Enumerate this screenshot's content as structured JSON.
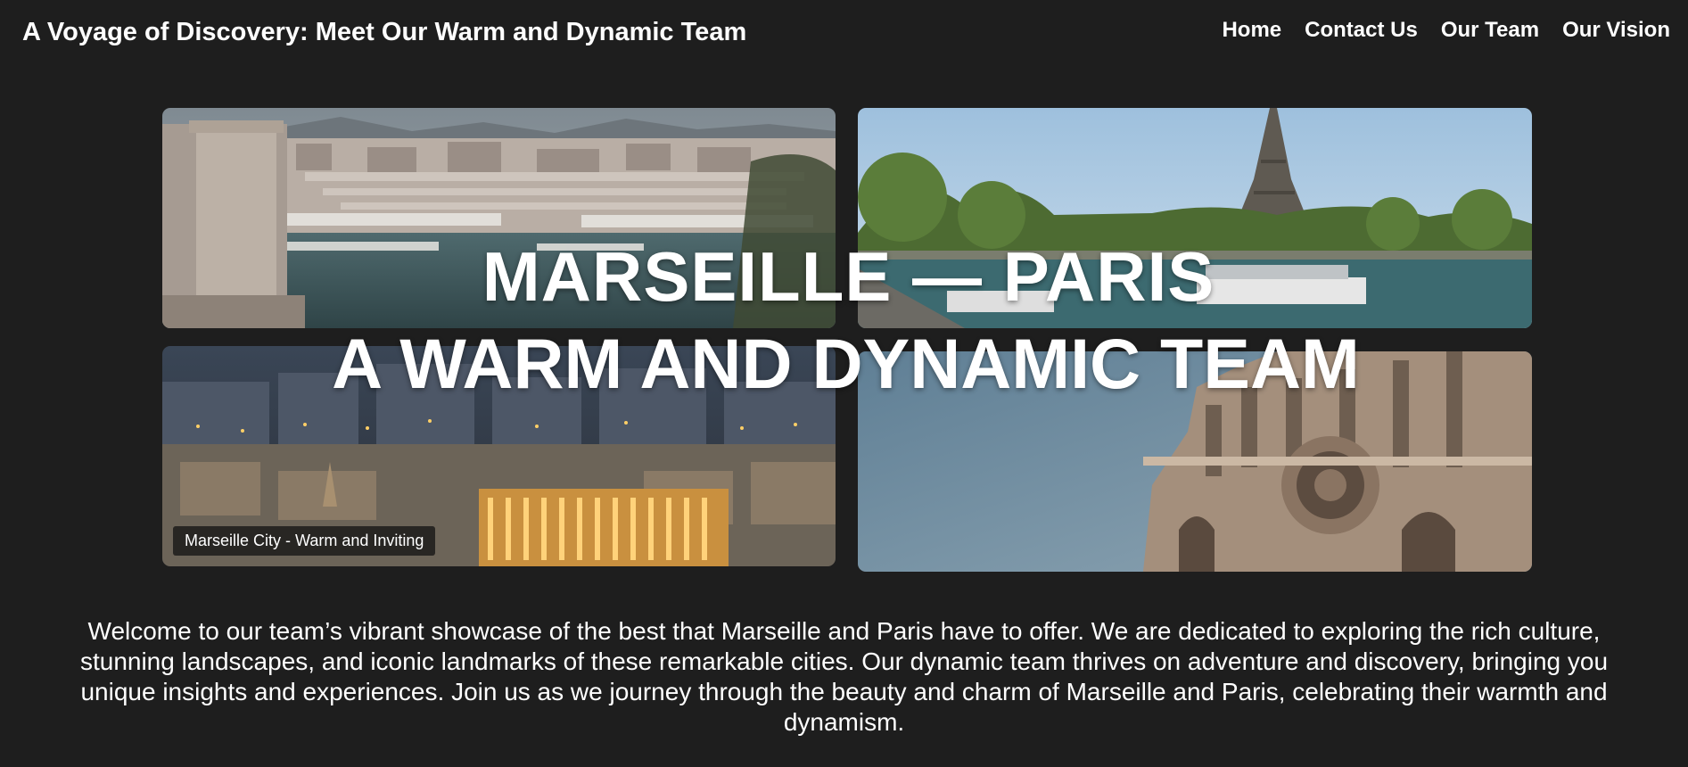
{
  "header": {
    "title": "A Voyage of Discovery: Meet Our Warm and Dynamic Team",
    "nav": [
      {
        "label": "Home"
      },
      {
        "label": "Contact Us"
      },
      {
        "label": "Our Team"
      },
      {
        "label": "Our Vision"
      }
    ]
  },
  "hero": {
    "line1": "MARSEILLE — PARIS",
    "line2": "A WARM AND DYNAMIC TEAM",
    "tiles": [
      {
        "name": "marseille-port-photo"
      },
      {
        "name": "paris-eiffel-photo"
      },
      {
        "name": "marseille-night-photo",
        "caption": "Marseille City - Warm and Inviting"
      },
      {
        "name": "notre-dame-photo"
      }
    ]
  },
  "intro": {
    "text": "Welcome to our team’s vibrant showcase of the best that Marseille and Paris have to offer. We are dedicated to exploring the rich culture, stunning landscapes, and iconic landmarks of these remarkable cities. Our dynamic team thrives on adventure and discovery, bringing you unique insights and experiences. Join us as we journey through the beauty and charm of Marseille and Paris, celebrating their warmth and dynamism."
  },
  "colors": {
    "background": "#1e1e1e",
    "text": "#ffffff"
  }
}
